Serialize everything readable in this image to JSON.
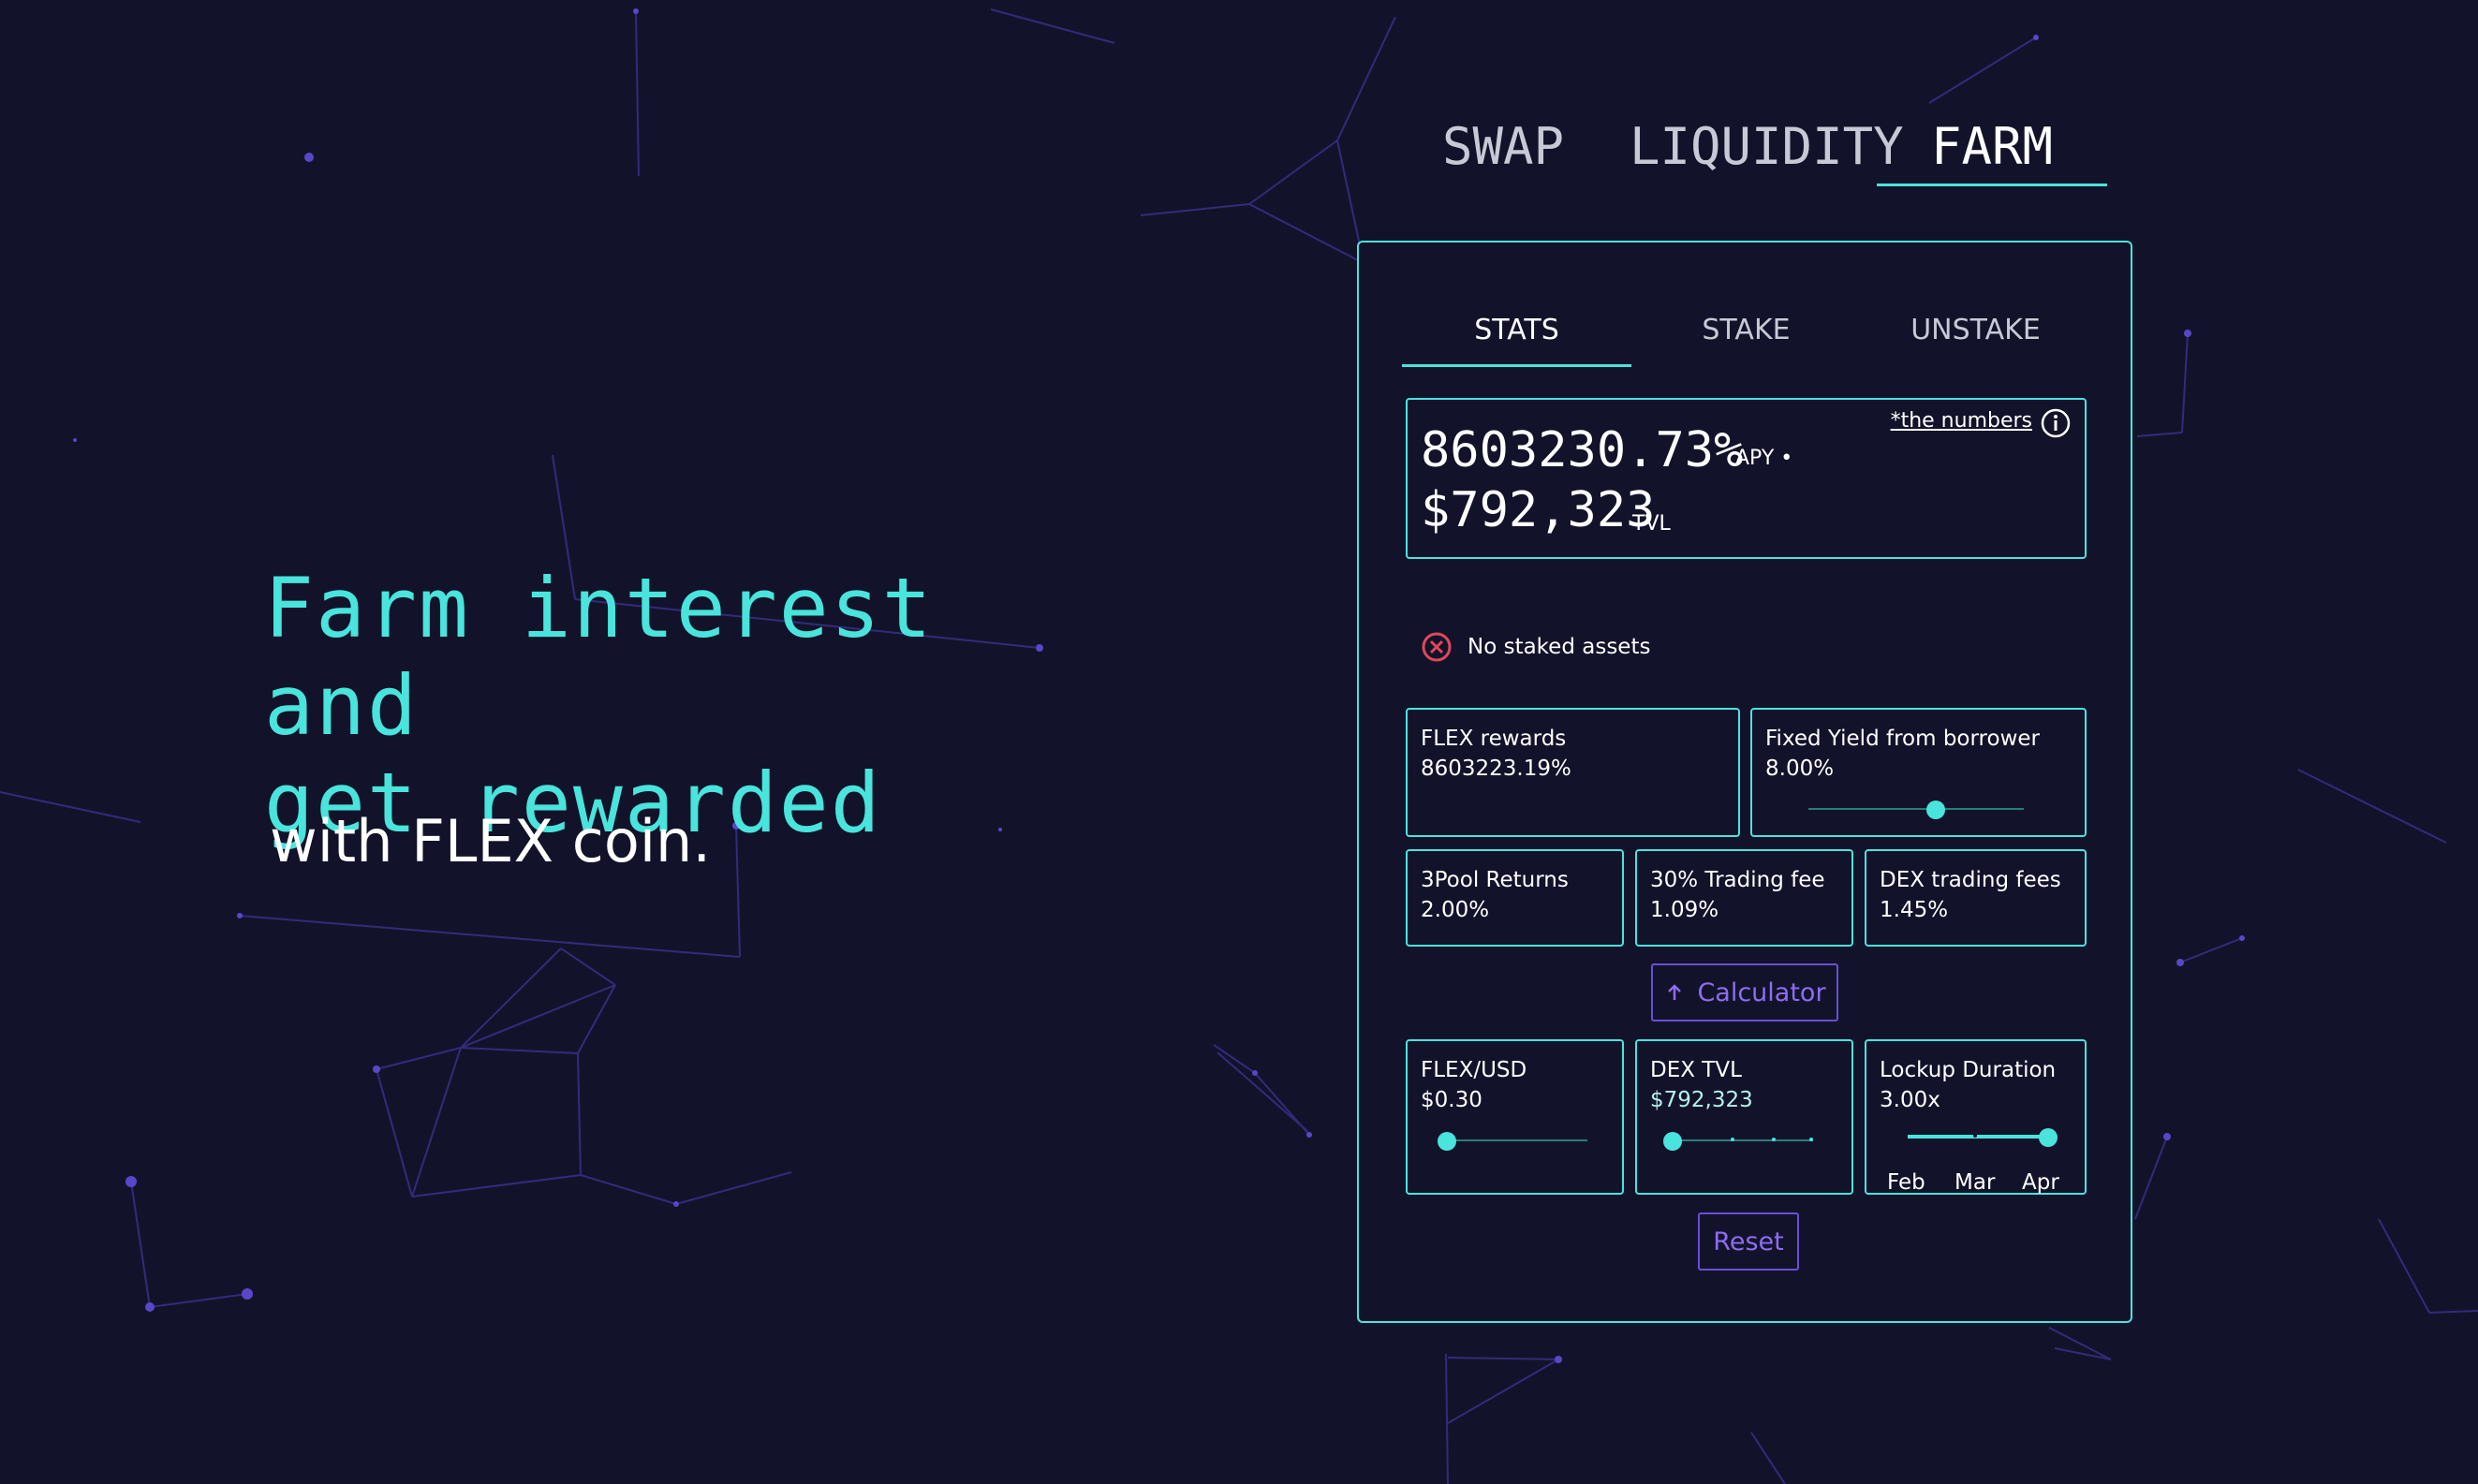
{
  "hero": {
    "title": "Farm interest and\nget rewarded",
    "subtitle": "with FLEX coin."
  },
  "top_nav": {
    "tabs": [
      {
        "label": "SWAP"
      },
      {
        "label": "LIQUIDITY"
      },
      {
        "label": "FARM",
        "active": true
      }
    ]
  },
  "panel": {
    "sub_tabs": [
      {
        "label": "STATS",
        "active": true
      },
      {
        "label": "STAKE"
      },
      {
        "label": "UNSTAKE"
      }
    ],
    "summary": {
      "apy_value": "8603230.73%",
      "apy_suffix": "APY",
      "tvl_value": "$792,323",
      "tvl_suffix": "TVL",
      "numbers_link": "*the numbers",
      "info_icon": "info-circle-icon"
    },
    "status": {
      "icon": "error-circle-icon",
      "text": "No staked assets"
    },
    "flex_rewards": {
      "label": "FLEX rewards",
      "value": "8603223.19%"
    },
    "fixed_yield": {
      "label": "Fixed Yield from borrower",
      "value": "8.00%",
      "slider_level": 0.59
    },
    "pool_returns": {
      "label": "3Pool Returns",
      "value": "2.00%"
    },
    "trading_fee": {
      "label": "30% Trading fee",
      "value": "1.09%"
    },
    "dex_fees": {
      "label": "DEX trading fees",
      "value": "1.45%"
    },
    "calculator_button": {
      "icon": "arrow-up-icon",
      "label": "Calculator"
    },
    "flex_usd": {
      "label": "FLEX/USD",
      "value": "$0.30",
      "slider_level": 0.0
    },
    "dex_tvl": {
      "label": "DEX TVL",
      "value": "$792,323",
      "slider_level": 0.0
    },
    "lockup": {
      "label": "Lockup Duration",
      "value": "3.00x",
      "slider_level": 1.0,
      "months": [
        "Feb",
        "Mar",
        "Apr"
      ]
    },
    "reset_button": {
      "label": "Reset"
    }
  },
  "colors": {
    "background": "#12132a",
    "accent": "#49e4dc",
    "button_purple": "#6a4fd8",
    "error": "#e0475a"
  }
}
